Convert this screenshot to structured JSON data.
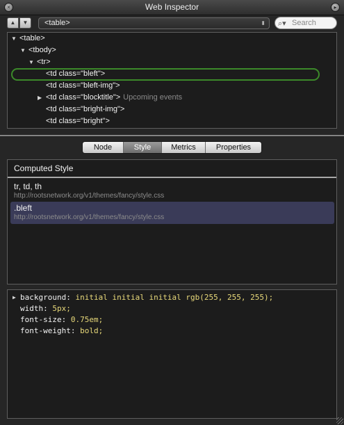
{
  "window": {
    "title": "Web Inspector"
  },
  "toolbar": {
    "breadcrumb": "<table>",
    "search_placeholder": "Search"
  },
  "dom_tree": [
    {
      "text": "<table>",
      "expanded": true
    },
    {
      "text": "<tbody>",
      "expanded": true
    },
    {
      "text": "<tr>",
      "expanded": true
    },
    {
      "text": "<td class=\"bleft\">",
      "selected": true
    },
    {
      "text": "<td class=\"bleft-img\">"
    },
    {
      "text": "<td class=\"blocktitle\">",
      "collapsed": true,
      "note": "Upcoming events"
    },
    {
      "text": "<td class=\"bright-img\">"
    },
    {
      "text": "<td class=\"bright\">"
    }
  ],
  "tabs": [
    {
      "label": "Node",
      "active": false
    },
    {
      "label": "Style",
      "active": true
    },
    {
      "label": "Metrics",
      "active": false
    },
    {
      "label": "Properties",
      "active": false
    }
  ],
  "computed_style": {
    "header": "Computed Style",
    "rules": [
      {
        "selector": "tr, td, th",
        "source": "http://rootsnetwork.org/v1/themes/fancy/style.css",
        "highlighted": false
      },
      {
        "selector": ".bleft",
        "source": "http://rootsnetwork.org/v1/themes/fancy/style.css",
        "highlighted": true
      }
    ]
  },
  "properties": [
    {
      "name": "background",
      "value": "initial initial initial rgb(255, 255, 255);",
      "expandable": true
    },
    {
      "name": "width",
      "value": "5px;"
    },
    {
      "name": "font-size",
      "value": "0.75em;"
    },
    {
      "name": "font-weight",
      "value": "bold;"
    }
  ],
  "colors": {
    "selection_outline": "#3c8a2a",
    "rule_highlight": "#3a3b58",
    "property_value": "#e8d97a"
  }
}
